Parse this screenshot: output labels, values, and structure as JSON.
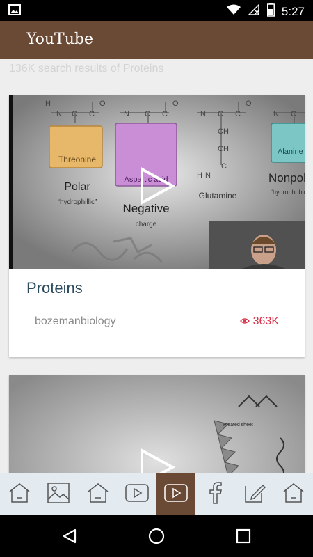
{
  "status_bar": {
    "time": "5:27"
  },
  "app": {
    "title": "YouTube"
  },
  "search": {
    "results_text": "136K search results of Proteins"
  },
  "videos": [
    {
      "title": "Proteins",
      "channel": "bozemanbiology",
      "views": "363K",
      "thumbnail_labels": [
        "Threonine",
        "Polar",
        "“hydrophillic”",
        "Aspartic acid",
        "Negative",
        "charge",
        "Glutamine",
        "Alanine",
        "Nonpolar",
        "“hydrophobic”"
      ]
    },
    {
      "thumbnail_labels": [
        "Pleated sheet"
      ]
    }
  ],
  "bottom_nav": {
    "items": [
      "home-icon",
      "image-icon",
      "home-icon",
      "youtube-icon",
      "youtube-icon",
      "facebook-icon",
      "edit-icon",
      "home-icon"
    ],
    "active_index": 4
  },
  "colors": {
    "appbar": "#6b4a35",
    "title_text": "#2b4a5c",
    "views": "#d9334a",
    "nav_bg": "#e3ebf1"
  }
}
